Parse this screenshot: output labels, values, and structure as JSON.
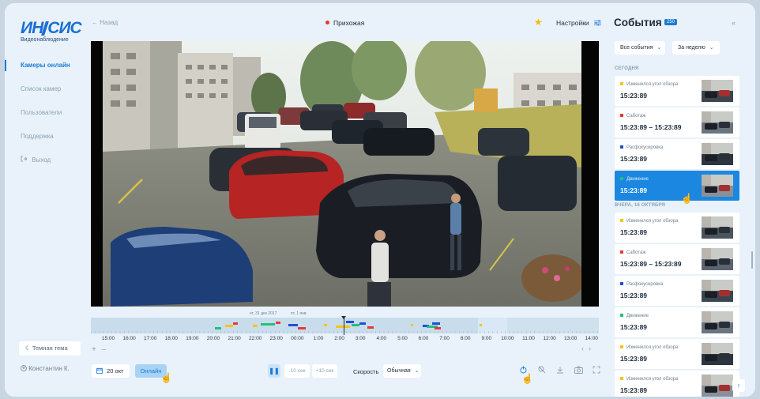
{
  "brand": {
    "logo_left": "ИН",
    "logo_right": "СИС",
    "subtitle": "Видеонаблюдение"
  },
  "nav": {
    "items": [
      {
        "label": "Камеры онлайн",
        "active": true
      },
      {
        "label": "Список камер",
        "active": false
      },
      {
        "label": "Пользователи",
        "active": false
      },
      {
        "label": "Поддержка",
        "active": false
      },
      {
        "label": "Выход",
        "active": false,
        "icon": "logout-icon"
      }
    ]
  },
  "sidebar_footer": {
    "theme_label": "Темная тема",
    "user_name": "Константин К."
  },
  "header": {
    "back_label": "Назад",
    "camera_name": "Прихожая",
    "settings_label": "Настройки"
  },
  "timeline": {
    "date_left": "чт, 31 дек 2017",
    "date_right": "пт, 1 янв",
    "labels": [
      "15:00",
      "16:00",
      "17:00",
      "18:00",
      "19:00",
      "20:00",
      "21:00",
      "22:00",
      "23:00",
      "00:00",
      "1:00",
      "2:00",
      "3:00",
      "4:00",
      "5:00",
      "6:00",
      "7:00",
      "8:00",
      "9:00",
      "10:00",
      "11:00",
      "12:00",
      "13:00",
      "14:00"
    ]
  },
  "controls": {
    "date": "20 окт",
    "online": "Онлайн",
    "back10": "-10 сек",
    "fwd10": "+10 сек",
    "speed_label": "Скорость",
    "speed_value": "Обычная"
  },
  "events": {
    "title": "События",
    "count": "250",
    "filter_type": "Все события",
    "filter_period": "За неделю",
    "groups": [
      {
        "label": "СЕГОДНЯ",
        "items": [
          {
            "type": "Изменился угол обзора",
            "color": "#f5c518",
            "time": "15:23:89"
          },
          {
            "type": "Саботаж",
            "color": "#e53935",
            "time": "15:23:89 – 15:23:89"
          },
          {
            "type": "Расфокусировка",
            "color": "#1e4fd8",
            "time": "15:23:89"
          },
          {
            "type": "Движение",
            "color": "#22c07a",
            "time": "15:23:89",
            "selected": true
          }
        ]
      },
      {
        "label": "ВЧЕРА, 16 ОКТЯБРЯ",
        "items": [
          {
            "type": "Изменился угол обзора",
            "color": "#f5c518",
            "time": "15:23:89"
          },
          {
            "type": "Саботаж",
            "color": "#e53935",
            "time": "15:23:89 – 15:23:89"
          },
          {
            "type": "Расфокусировка",
            "color": "#1e4fd8",
            "time": "15:23:89"
          },
          {
            "type": "Движение",
            "color": "#22c07a",
            "time": "15:23:89"
          },
          {
            "type": "Изменился угол обзора",
            "color": "#f5c518",
            "time": "15:23:89"
          },
          {
            "type": "Изменился угол обзора",
            "color": "#f5c518",
            "time": "15:23:89"
          }
        ]
      }
    ]
  },
  "colors": {
    "accent": "#1b7bd8",
    "star": "#f5b800",
    "live_dot": "#e53935"
  }
}
